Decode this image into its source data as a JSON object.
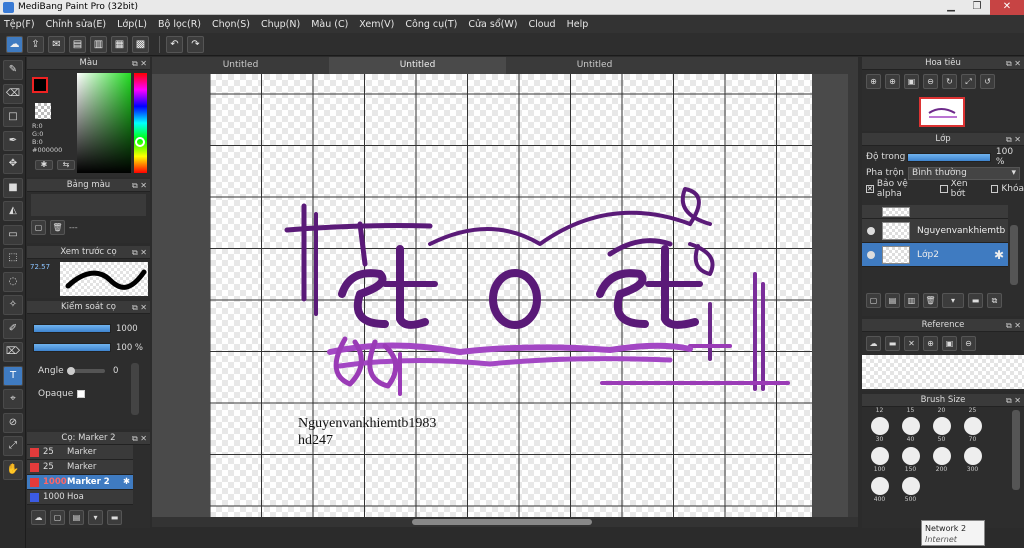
{
  "window": {
    "title": "MediBang Paint Pro (32bit)"
  },
  "menu": [
    "Tệp(F)",
    "Chỉnh sửa(E)",
    "Lớp(L)",
    "Bộ lọc(R)",
    "Chọn(S)",
    "Chụp(N)",
    "Màu (C)",
    "Xem(V)",
    "Công cụ(T)",
    "Cửa sổ(W)",
    "Cloud",
    "Help"
  ],
  "tabs": [
    "Untitled",
    "Untitled",
    "Untitled"
  ],
  "color_panel": {
    "title": "Màu",
    "r": "R:0",
    "g": "G:0",
    "b": "B:0",
    "hex": "#000000"
  },
  "palette_panel": {
    "title": "Bảng màu",
    "dash": "---"
  },
  "preview_panel": {
    "title": "Xem trước cọ",
    "value": "72.57"
  },
  "control_panel": {
    "title": "Kiểm soát cọ",
    "size": "1000",
    "opacity": "100 %",
    "angle_label": "Angle",
    "angle_value": "0",
    "opaque_label": "Opaque"
  },
  "brush_panel": {
    "title": "Cọ: Marker 2",
    "items": [
      {
        "size": "25",
        "name": "Marker",
        "color": "#e33b3b"
      },
      {
        "size": "25",
        "name": "Marker",
        "color": "#e33b3b"
      },
      {
        "size": "1000",
        "name": "Marker 2",
        "color": "#e33b3b"
      },
      {
        "size": "1000",
        "name": "Hoa",
        "color": "#3b5be3"
      }
    ]
  },
  "navigator": {
    "title": "Hoa tiêu"
  },
  "layers": {
    "title": "Lớp",
    "opacity_label": "Độ trong",
    "opacity_value": "100 %",
    "blend_label": "Pha trộn",
    "blend_value": "Bình thường",
    "protect_alpha": "Bảo vệ alpha",
    "clipping": "Xén bớt",
    "lock": "Khóa",
    "items": [
      {
        "name": ""
      },
      {
        "name": "Nguyenvankhiemtb"
      },
      {
        "name": "Lớp2"
      }
    ]
  },
  "reference": {
    "title": "Reference"
  },
  "brush_size": {
    "title": "Brush Size",
    "top_labels": [
      "12",
      "15",
      "20",
      "25"
    ],
    "rows": [
      [
        "30",
        "40",
        "50",
        "70"
      ],
      [
        "100",
        "150",
        "200",
        "300"
      ],
      [
        "400",
        "500",
        "",
        ""
      ]
    ]
  },
  "canvas": {
    "text_line1": "Nguyenvankhiemtb1983",
    "text_line2": "hd247"
  },
  "tooltip": {
    "title": "Network  2",
    "subtitle": "Internet access"
  },
  "colors": {
    "accent": "#3f7bc1",
    "stroke": "#5a1a78",
    "stroke_light": "#a347c4"
  }
}
